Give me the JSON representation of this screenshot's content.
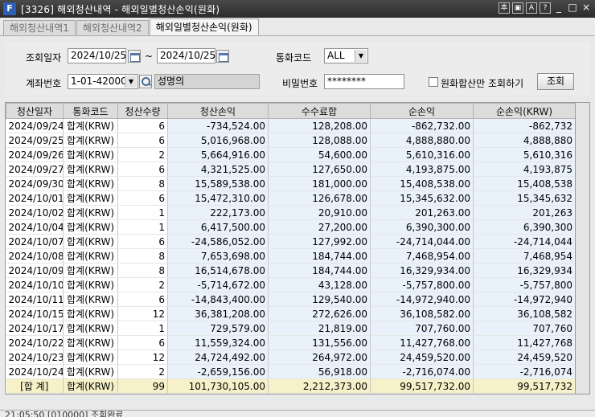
{
  "window": {
    "title": "[3326] 해외청산내역 - 해외일별청산손익(원화)",
    "title_buttons": [
      "本",
      "▣",
      "A",
      "?",
      "_",
      "□",
      "×"
    ]
  },
  "tabs": [
    {
      "label": "해외청산내역1",
      "active": false
    },
    {
      "label": "해외청산내역2",
      "active": false
    },
    {
      "label": "해외일별청산손익(원화)",
      "active": true
    }
  ],
  "form": {
    "query_date_label": "조회일자",
    "date_from": "2024/10/25",
    "date_sep": "~",
    "date_to": "2024/10/25",
    "currency_label": "통화코드",
    "currency_value": "ALL",
    "account_label": "계좌번호",
    "account_value": "1-01-42000",
    "account_name": "성명의",
    "password_label": "비밀번호",
    "password_value": "********",
    "krw_only_label": "원화합산만 조회하기",
    "krw_only_checked": false,
    "search_button": "조회"
  },
  "grid": {
    "columns": [
      "청산일자",
      "통화코드",
      "청산수량",
      "청산손익",
      "수수료합",
      "순손익",
      "순손익(KRW)"
    ],
    "rows": [
      [
        "2024/09/24",
        "합계(KRW)",
        "6",
        "-734,524.00",
        "128,208.00",
        "-862,732.00",
        "-862,732"
      ],
      [
        "2024/09/25",
        "합계(KRW)",
        "6",
        "5,016,968.00",
        "128,088.00",
        "4,888,880.00",
        "4,888,880"
      ],
      [
        "2024/09/26",
        "합계(KRW)",
        "2",
        "5,664,916.00",
        "54,600.00",
        "5,610,316.00",
        "5,610,316"
      ],
      [
        "2024/09/27",
        "합계(KRW)",
        "6",
        "4,321,525.00",
        "127,650.00",
        "4,193,875.00",
        "4,193,875"
      ],
      [
        "2024/09/30",
        "합계(KRW)",
        "8",
        "15,589,538.00",
        "181,000.00",
        "15,408,538.00",
        "15,408,538"
      ],
      [
        "2024/10/01",
        "합계(KRW)",
        "6",
        "15,472,310.00",
        "126,678.00",
        "15,345,632.00",
        "15,345,632"
      ],
      [
        "2024/10/02",
        "합계(KRW)",
        "1",
        "222,173.00",
        "20,910.00",
        "201,263.00",
        "201,263"
      ],
      [
        "2024/10/04",
        "합계(KRW)",
        "1",
        "6,417,500.00",
        "27,200.00",
        "6,390,300.00",
        "6,390,300"
      ],
      [
        "2024/10/07",
        "합계(KRW)",
        "6",
        "-24,586,052.00",
        "127,992.00",
        "-24,714,044.00",
        "-24,714,044"
      ],
      [
        "2024/10/08",
        "합계(KRW)",
        "8",
        "7,653,698.00",
        "184,744.00",
        "7,468,954.00",
        "7,468,954"
      ],
      [
        "2024/10/09",
        "합계(KRW)",
        "8",
        "16,514,678.00",
        "184,744.00",
        "16,329,934.00",
        "16,329,934"
      ],
      [
        "2024/10/10",
        "합계(KRW)",
        "2",
        "-5,714,672.00",
        "43,128.00",
        "-5,757,800.00",
        "-5,757,800"
      ],
      [
        "2024/10/11",
        "합계(KRW)",
        "6",
        "-14,843,400.00",
        "129,540.00",
        "-14,972,940.00",
        "-14,972,940"
      ],
      [
        "2024/10/15",
        "합계(KRW)",
        "12",
        "36,381,208.00",
        "272,626.00",
        "36,108,582.00",
        "36,108,582"
      ],
      [
        "2024/10/17",
        "합계(KRW)",
        "1",
        "729,579.00",
        "21,819.00",
        "707,760.00",
        "707,760"
      ],
      [
        "2024/10/22",
        "합계(KRW)",
        "6",
        "11,559,324.00",
        "131,556.00",
        "11,427,768.00",
        "11,427,768"
      ],
      [
        "2024/10/23",
        "합계(KRW)",
        "12",
        "24,724,492.00",
        "264,972.00",
        "24,459,520.00",
        "24,459,520"
      ],
      [
        "2024/10/24",
        "합계(KRW)",
        "2",
        "-2,659,156.00",
        "56,918.00",
        "-2,716,074.00",
        "-2,716,074"
      ]
    ],
    "total": [
      "[합 계]",
      "합계(KRW)",
      "99",
      "101,730,105.00",
      "2,212,373.00",
      "99,517,732.00",
      "99,517,732"
    ]
  },
  "status": {
    "text": "21:05:50 [010000] 조회완료"
  }
}
